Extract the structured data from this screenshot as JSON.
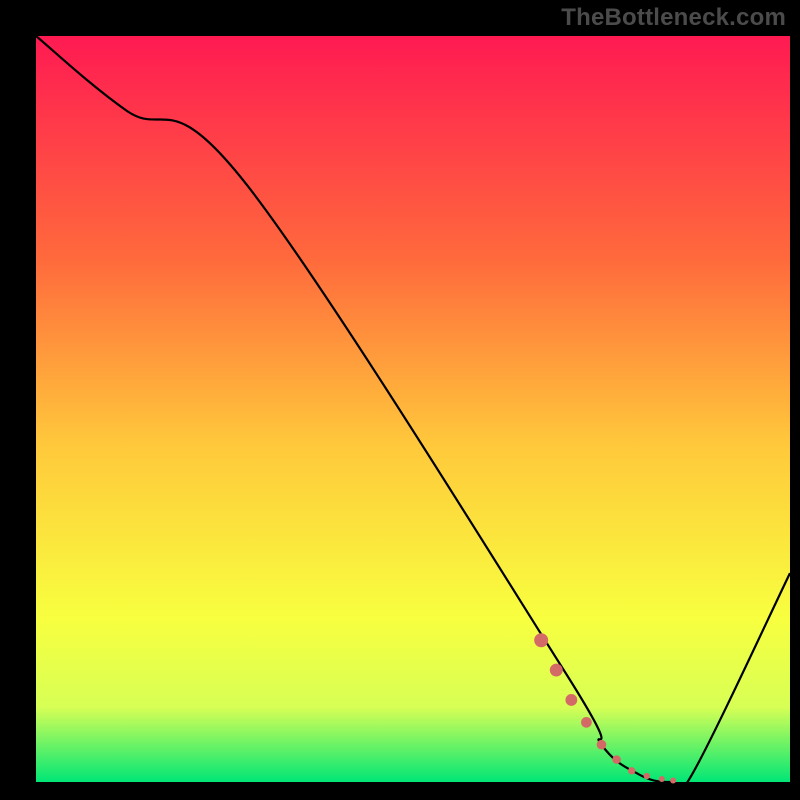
{
  "watermark": "TheBottleneck.com",
  "colors": {
    "background": "#000000",
    "watermark_text": "#4b4b4b",
    "gradient_top": "#ff1a52",
    "gradient_mid1": "#ff6a3c",
    "gradient_mid2": "#ffc93b",
    "gradient_mid3": "#f8ff3f",
    "gradient_mid4": "#d7ff55",
    "gradient_bottom": "#00e676",
    "curve_stroke": "#000000",
    "marker_fill": "#d46a65"
  },
  "chart_data": {
    "type": "line",
    "title": "",
    "xlabel": "",
    "ylabel": "",
    "xlim": [
      0,
      100
    ],
    "ylim": [
      0,
      100
    ],
    "grid": false,
    "legend": false,
    "series": [
      {
        "name": "bottleneck-curve",
        "x": [
          0,
          12,
          28,
          70,
          75,
          80,
          84,
          87,
          100
        ],
        "y": [
          100,
          90,
          80,
          15,
          5,
          1,
          0,
          1,
          28
        ]
      }
    ],
    "markers": {
      "name": "highlight-segment",
      "x": [
        67,
        69,
        71,
        73,
        75,
        77,
        79,
        81,
        83,
        84.5
      ],
      "y": [
        19,
        15,
        11,
        8,
        5,
        3,
        1.5,
        0.8,
        0.4,
        0.2
      ]
    }
  }
}
